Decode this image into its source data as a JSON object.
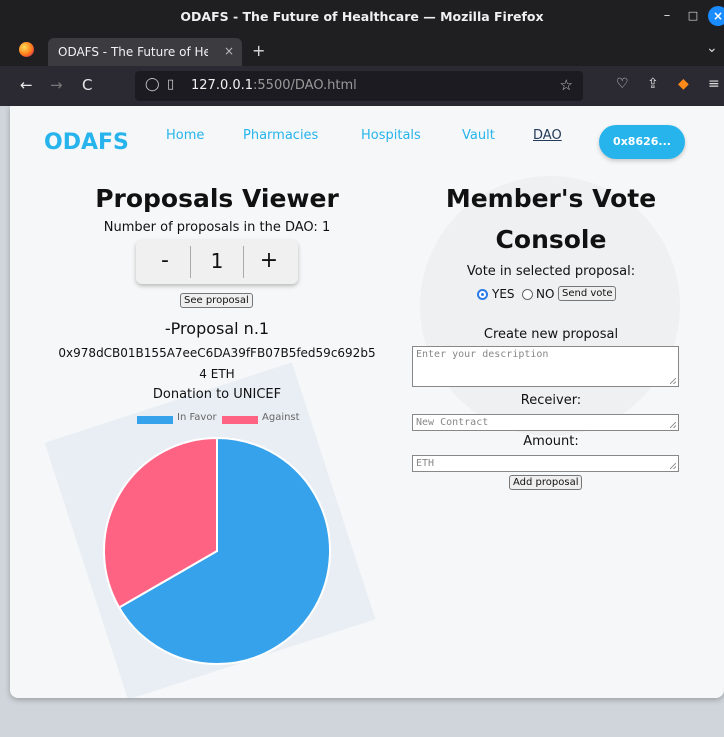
{
  "window": {
    "title": "ODAFS - The Future of Healthcare — Mozilla Firefox"
  },
  "tab": {
    "label": "ODAFS - The Future of Healt",
    "close": "×"
  },
  "toolbar": {
    "newtab": "+",
    "tabmenu": "⌄",
    "back": "←",
    "forward": "→",
    "reload": "C",
    "menu": "≡"
  },
  "url": {
    "host": "127.0.0.1",
    "rest": ":5500/DAO.html"
  },
  "header": {
    "brand": "ODAFS",
    "nav": [
      "Home",
      "Pharmacies",
      "Hospitals",
      "Vault",
      "DAO"
    ],
    "wallet": "0x8626..."
  },
  "viewer": {
    "title": "Proposals Viewer",
    "count_text": "Number of proposals in the DAO: 1",
    "stepper": {
      "minus": "-",
      "value": "1",
      "plus": "+"
    },
    "see_button": "See proposal",
    "proposal_title": "-Proposal n.1",
    "address": "0x978dCB01B155A7eeC6DA39fFB07B5fed59c692b5",
    "amount": "4 ETH",
    "description": "Donation to UNICEF"
  },
  "chart_data": {
    "type": "pie",
    "labels": [
      "In Favor",
      "Against"
    ],
    "values": [
      2,
      1
    ],
    "colors": [
      "#36a2eb",
      "#ff6384"
    ],
    "legend": "top"
  },
  "vote": {
    "title_line1": "Member's Vote",
    "title_line2": "Console",
    "prompt": "Vote in selected proposal:",
    "yes": "YES",
    "no": "NO",
    "send": "Send vote",
    "create_title": "Create new proposal",
    "desc_placeholder": "Enter your description",
    "receiver_label": "Receiver:",
    "receiver_placeholder": "New Contract",
    "amount_label": "Amount:",
    "amount_placeholder": "ETH",
    "add_button": "Add proposal"
  }
}
